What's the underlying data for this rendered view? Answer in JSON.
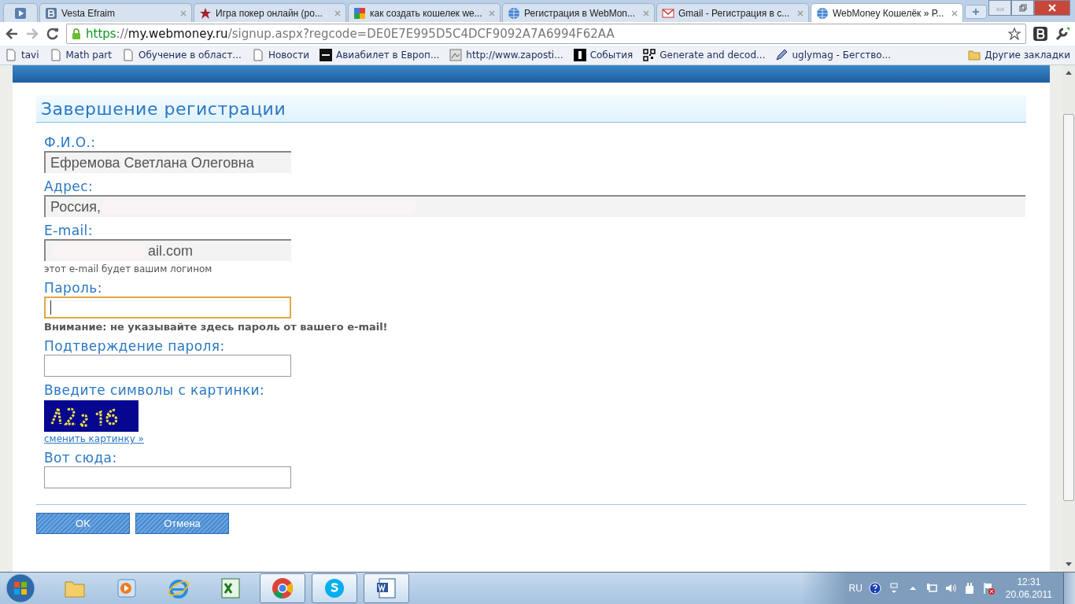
{
  "tabs": [
    {
      "selected": false
    },
    {
      "title": "Vesta Efraim",
      "selected": false
    },
    {
      "title": "Игра покер онлайн (ро...",
      "selected": false
    },
    {
      "title": "как создать кошелек we...",
      "selected": false
    },
    {
      "title": "Регистрация в WebMon...",
      "selected": false
    },
    {
      "title": "Gmail - Регистрация в с...",
      "selected": false
    },
    {
      "title": "WebMoney Кошелёк » Р...",
      "selected": true
    }
  ],
  "address_bar": {
    "scheme": "https",
    "separator": "://",
    "host": "my.webmoney.ru",
    "path": "/signup.aspx?regcode=DE0E7E995D5C4DCF9092A7A6994F62AA"
  },
  "bookmarks": [
    "tavi",
    "Math part",
    "Обучение в област...",
    "Новости",
    "Авиабилет в Европ...",
    "http://www.zaposti...",
    "События",
    "Generate and decod...",
    "uglymag - Бегство..."
  ],
  "other_bookmarks": "Другие закладки",
  "page": {
    "title": "Завершение регистрации",
    "fields": [
      {
        "kind": "readonly",
        "label": "Ф.И.О.:",
        "value": "Ефремова Светлана Олеговна"
      },
      {
        "kind": "readonly",
        "label": "Адрес:",
        "value": "Россия,"
      },
      {
        "kind": "readonly",
        "label": "E-mail:",
        "value": "ail.com",
        "hint": "этот e-mail будет вашим логином"
      },
      {
        "kind": "input",
        "label": "Пароль:",
        "focused": true,
        "warning": "Внимание: не указывайте здесь пароль от вашего e-mail!"
      },
      {
        "kind": "input",
        "label": "Подтверждение пароля:",
        "focused": false
      },
      {
        "kind": "captcha",
        "label": "Введите символы с картинки:",
        "link": "сменить картинку »"
      },
      {
        "kind": "input",
        "label": "Вот сюда:",
        "focused": false
      }
    ],
    "buttons": [
      "OK",
      "Отмена"
    ]
  },
  "taskbar": {
    "apps": [
      {
        "open": false
      },
      {
        "open": false
      },
      {
        "open": false
      },
      {
        "open": false
      },
      {
        "open": true
      },
      {
        "open": true
      },
      {
        "open": true
      }
    ],
    "language": "RU",
    "time": "12:31",
    "date": "20.06.2011"
  }
}
